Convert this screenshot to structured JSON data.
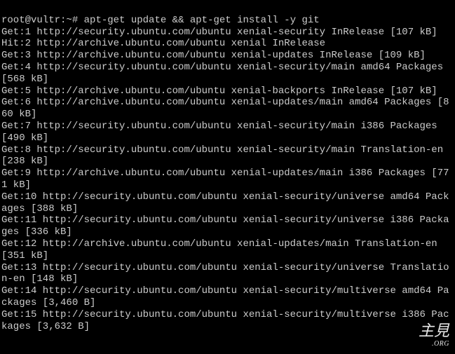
{
  "prompt": {
    "user_host": "root@vultr",
    "cwd": "~",
    "symbol": "#",
    "command": "apt-get update && apt-get install -y git"
  },
  "lines": [
    "Get:1 http://security.ubuntu.com/ubuntu xenial-security InRelease [107 kB]",
    "Hit:2 http://archive.ubuntu.com/ubuntu xenial InRelease",
    "Get:3 http://archive.ubuntu.com/ubuntu xenial-updates InRelease [109 kB]",
    "Get:4 http://security.ubuntu.com/ubuntu xenial-security/main amd64 Packages [568 kB]",
    "Get:5 http://archive.ubuntu.com/ubuntu xenial-backports InRelease [107 kB]",
    "Get:6 http://archive.ubuntu.com/ubuntu xenial-updates/main amd64 Packages [860 kB]",
    "Get:7 http://security.ubuntu.com/ubuntu xenial-security/main i386 Packages [490 kB]",
    "Get:8 http://security.ubuntu.com/ubuntu xenial-security/main Translation-en [238 kB]",
    "Get:9 http://archive.ubuntu.com/ubuntu xenial-updates/main i386 Packages [771 kB]",
    "Get:10 http://security.ubuntu.com/ubuntu xenial-security/universe amd64 Packages [388 kB]",
    "Get:11 http://security.ubuntu.com/ubuntu xenial-security/universe i386 Packages [336 kB]",
    "Get:12 http://archive.ubuntu.com/ubuntu xenial-updates/main Translation-en [351 kB]",
    "Get:13 http://security.ubuntu.com/ubuntu xenial-security/universe Translation-en [148 kB]",
    "Get:14 http://security.ubuntu.com/ubuntu xenial-security/multiverse amd64 Packages [3,460 B]",
    "Get:15 http://security.ubuntu.com/ubuntu xenial-security/multiverse i386 Packages [3,632 B]"
  ],
  "watermark": {
    "main": "主見",
    "sub": ".ORG"
  }
}
